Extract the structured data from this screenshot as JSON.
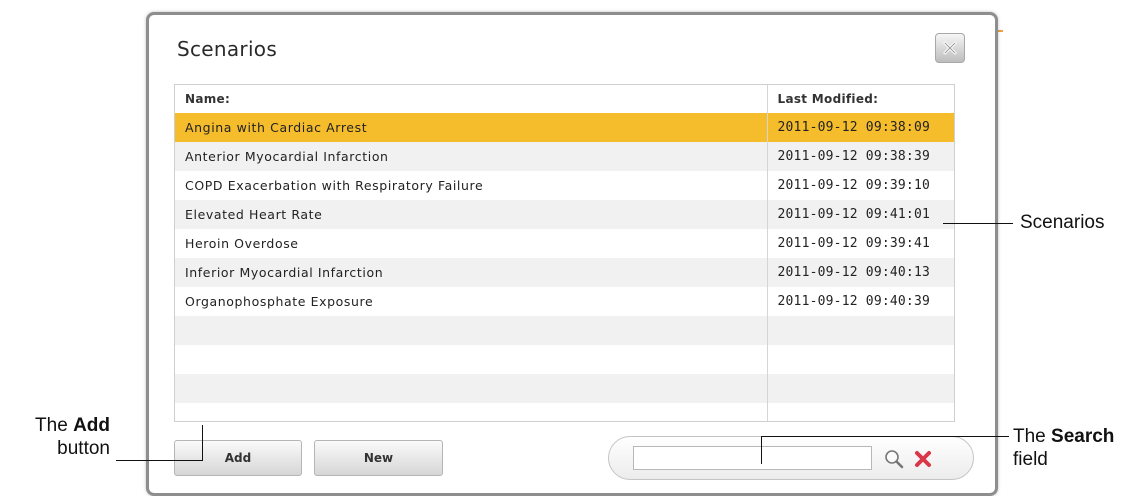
{
  "dialog": {
    "title": "Scenarios",
    "close_icon": "close-x-icon"
  },
  "table": {
    "headers": {
      "name": "Name:",
      "last_modified": "Last Modified:"
    },
    "rows": [
      {
        "name": "Angina with Cardiac Arrest",
        "modified": "2011-09-12 09:38:09",
        "selected": true
      },
      {
        "name": "Anterior Myocardial Infarction",
        "modified": "2011-09-12 09:38:39"
      },
      {
        "name": "COPD Exacerbation with Respiratory Failure",
        "modified": "2011-09-12 09:39:10"
      },
      {
        "name": "Elevated Heart Rate",
        "modified": "2011-09-12 09:41:01"
      },
      {
        "name": "Heroin Overdose",
        "modified": "2011-09-12 09:39:41"
      },
      {
        "name": "Inferior Myocardial Infarction",
        "modified": "2011-09-12 09:40:13"
      },
      {
        "name": "Organophosphate Exposure",
        "modified": "2011-09-12 09:40:39"
      }
    ],
    "selected_color": "#f5bd2c"
  },
  "buttons": {
    "add": "Add",
    "new": "New"
  },
  "search": {
    "value": "",
    "search_icon": "magnifier-icon",
    "clear_icon": "clear-x-icon"
  },
  "callouts": {
    "scenarios": "Scenarios",
    "add_prefix": "The ",
    "add_bold": "Add",
    "add_suffix": "button",
    "search_prefix": "The ",
    "search_bold": "Search",
    "search_suffix": "field"
  }
}
